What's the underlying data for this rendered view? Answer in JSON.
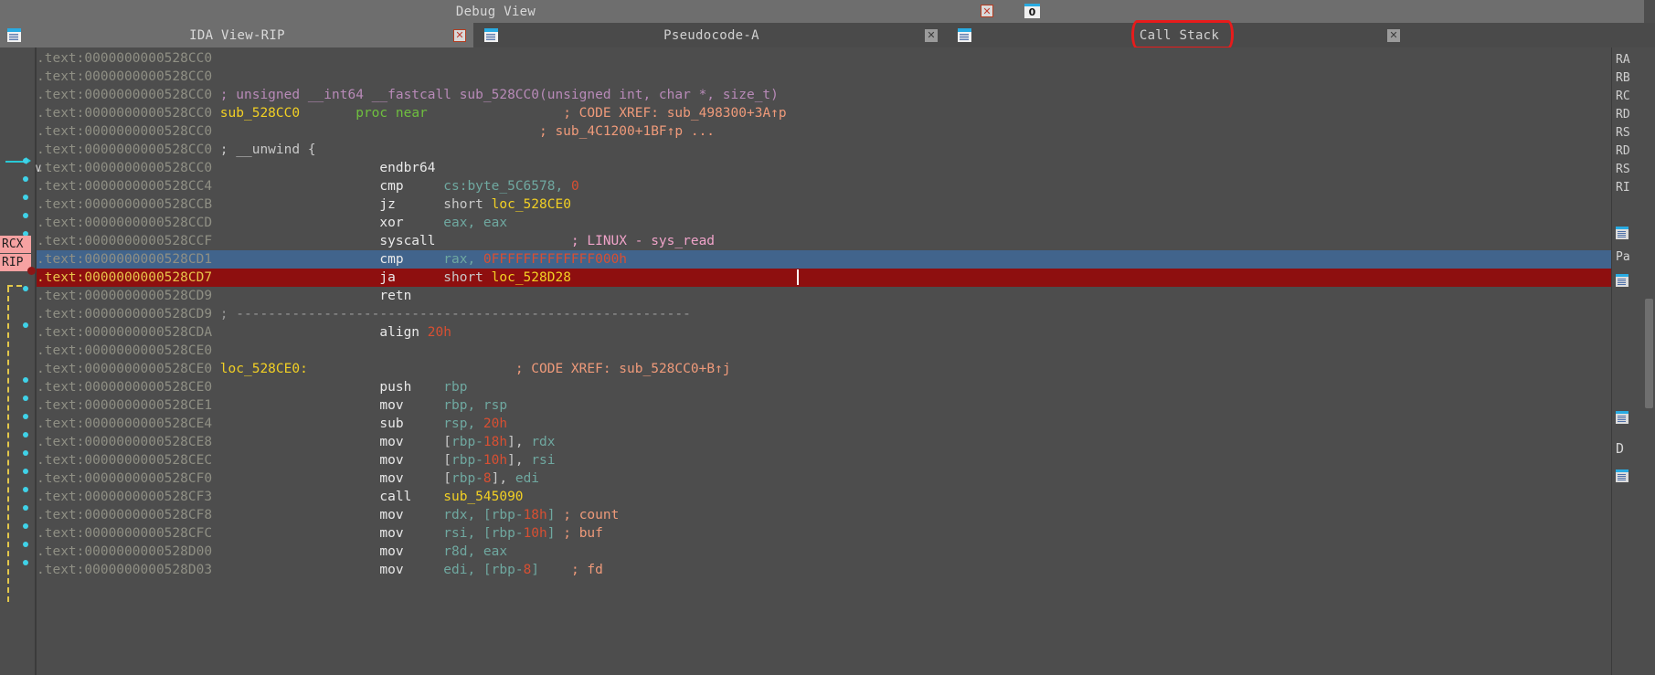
{
  "window": {
    "outer_tabs": [
      {
        "label": "Debug View",
        "active": true,
        "close_icon": "close-icon"
      }
    ],
    "terminal_icon": "terminal-icon"
  },
  "inner_tabs": [
    {
      "label": "IDA View-RIP",
      "icon": "document-icon",
      "close_icon": "close-icon",
      "active": false
    },
    {
      "label": "Pseudocode-A",
      "icon": "document-icon",
      "close_icon": "close-icon",
      "active": true
    },
    {
      "label": "Call Stack",
      "icon": "document-icon",
      "close_icon": "close-icon",
      "active": true,
      "annotated": true
    }
  ],
  "annotation": {
    "color": "#e81b1b",
    "shape": "hand-drawn-ellipse",
    "target": "Call Stack"
  },
  "registers_markers": [
    {
      "label": "RCX"
    },
    {
      "label": "RIP"
    }
  ],
  "right_panel": {
    "register_names": [
      "RA",
      "RB",
      "RC",
      "RD",
      "RS",
      "RD",
      "RS",
      "RI"
    ],
    "labels": {
      "pa": "Pa",
      "d": "D"
    }
  },
  "colors": {
    "background": "#4d4d4d",
    "selected_row": "#41648c",
    "current_row": "#8e0f0f",
    "address": "#8f8f84",
    "name": "#f2d024",
    "comment": "#ef9a7a",
    "number": "#d84f32",
    "register": "#6fa8a0",
    "keyword": "#6fbf3f",
    "annotation": "#e81b1b"
  },
  "disassembly": {
    "segment": ".text",
    "lines": [
      {
        "addr": "0000000000528CC0",
        "kind": "blank"
      },
      {
        "addr": "0000000000528CC0",
        "kind": "blank"
      },
      {
        "addr": "0000000000528CC0",
        "kind": "signature",
        "text": "; unsigned __int64 __fastcall sub_528CC0(unsigned int, char *, size_t)"
      },
      {
        "addr": "0000000000528CC0",
        "kind": "proc",
        "name": "sub_528CC0",
        "keyword": "proc near",
        "comment": "; CODE XREF: sub_498300+3A↑p"
      },
      {
        "addr": "0000000000528CC0",
        "kind": "comment_only",
        "comment": "; sub_4C1200+1BF↑p ..."
      },
      {
        "addr": "0000000000528CC0",
        "kind": "unwind",
        "text": "; __unwind {"
      },
      {
        "addr": "0000000000528CC0",
        "kind": "insn",
        "mnemonic": "endbr64",
        "operands": "",
        "marker": "arrow",
        "collapse": "v"
      },
      {
        "addr": "0000000000528CC4",
        "kind": "insn",
        "mnemonic": "cmp",
        "operands": "cs:byte_5C6578, 0",
        "marker": "dot"
      },
      {
        "addr": "0000000000528CCB",
        "kind": "insn",
        "mnemonic": "jz",
        "operands": "short loc_528CE0",
        "marker": "dot"
      },
      {
        "addr": "0000000000528CCD",
        "kind": "insn",
        "mnemonic": "xor",
        "operands": "eax, eax",
        "marker": "dot"
      },
      {
        "addr": "0000000000528CCF",
        "kind": "insn",
        "mnemonic": "syscall",
        "operands": "",
        "comment": "; LINUX - sys_read",
        "marker": "dot"
      },
      {
        "addr": "0000000000528CD1",
        "kind": "insn",
        "mnemonic": "cmp",
        "operands": "rax, 0FFFFFFFFFFFFF000h",
        "state": "selected"
      },
      {
        "addr": "0000000000528CD7",
        "kind": "insn",
        "mnemonic": "ja",
        "operands": "short loc_528D28",
        "state": "current"
      },
      {
        "addr": "0000000000528CD9",
        "kind": "insn",
        "mnemonic": "retn",
        "operands": ""
      },
      {
        "addr": "0000000000528CD9",
        "kind": "separator",
        "text": "; ---------------------------------------------------------"
      },
      {
        "addr": "0000000000528CDA",
        "kind": "directive",
        "mnemonic": "align",
        "operands": "20h",
        "marker": "dot"
      },
      {
        "addr": "0000000000528CE0",
        "kind": "blank"
      },
      {
        "addr": "0000000000528CE0",
        "kind": "label",
        "name": "loc_528CE0:",
        "comment": "; CODE XREF: sub_528CC0+B↑j"
      },
      {
        "addr": "0000000000528CE0",
        "kind": "insn",
        "mnemonic": "push",
        "operands": "rbp",
        "marker": "dot"
      },
      {
        "addr": "0000000000528CE1",
        "kind": "insn",
        "mnemonic": "mov",
        "operands": "rbp, rsp",
        "marker": "dot"
      },
      {
        "addr": "0000000000528CE4",
        "kind": "insn",
        "mnemonic": "sub",
        "operands": "rsp, 20h",
        "marker": "dot"
      },
      {
        "addr": "0000000000528CE8",
        "kind": "insn",
        "mnemonic": "mov",
        "operands": "[rbp-18h], rdx",
        "marker": "dot"
      },
      {
        "addr": "0000000000528CEC",
        "kind": "insn",
        "mnemonic": "mov",
        "operands": "[rbp-10h], rsi",
        "marker": "dot"
      },
      {
        "addr": "0000000000528CF0",
        "kind": "insn",
        "mnemonic": "mov",
        "operands": "[rbp-8], edi",
        "marker": "dot"
      },
      {
        "addr": "0000000000528CF3",
        "kind": "insn",
        "mnemonic": "call",
        "operands": "sub_545090",
        "marker": "dot"
      },
      {
        "addr": "0000000000528CF8",
        "kind": "insn",
        "mnemonic": "mov",
        "operands": "rdx, [rbp-18h]",
        "comment": "; count",
        "marker": "dot"
      },
      {
        "addr": "0000000000528CFC",
        "kind": "insn",
        "mnemonic": "mov",
        "operands": "rsi, [rbp-10h]",
        "comment": "; buf",
        "marker": "dot"
      },
      {
        "addr": "0000000000528D00",
        "kind": "insn",
        "mnemonic": "mov",
        "operands": "r8d, eax",
        "marker": "dot"
      },
      {
        "addr": "0000000000528D03",
        "kind": "insn",
        "mnemonic": "mov",
        "operands": "edi, [rbp-8]",
        "comment": "; fd",
        "marker": "dot"
      }
    ]
  }
}
